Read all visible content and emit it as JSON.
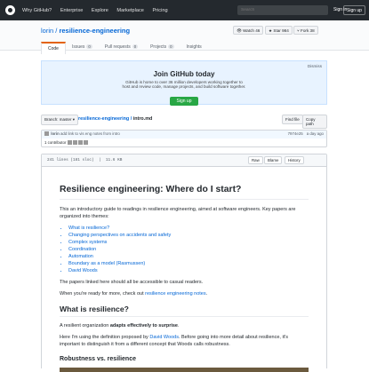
{
  "header": {
    "nav": [
      "Why GitHub?",
      "Enterprise",
      "Explore",
      "Marketplace",
      "Pricing"
    ],
    "search_placeholder": "Search",
    "signin": "Sign in",
    "signup": "Sign up"
  },
  "repo": {
    "owner": "lorin",
    "name": "resilience-engineering",
    "watch": "Watch",
    "watch_count": "46",
    "star": "Star",
    "star_count": "984",
    "fork": "Fork",
    "fork_count": "38"
  },
  "tabs": [
    {
      "label": "Code"
    },
    {
      "label": "Issues",
      "count": "0"
    },
    {
      "label": "Pull requests",
      "count": "0"
    },
    {
      "label": "Projects",
      "count": "0"
    },
    {
      "label": "Insights"
    }
  ],
  "join": {
    "title": "Join GitHub today",
    "text": "GitHub is home to over 36 million developers working together to host and review code, manage projects, and build software together.",
    "button": "Sign up",
    "dismiss": "Dismiss"
  },
  "file": {
    "branch": "Branch: master",
    "repo_link": "resilience-engineering",
    "sep": "/",
    "file": "intro.md",
    "find": "Find file",
    "copy": "Copy path"
  },
  "commit": {
    "author": "lorin",
    "message": "add link to vis eng notes from intro",
    "sha": "7974e25",
    "time": "a day ago",
    "contributors": "1 contributor"
  },
  "fileheader": {
    "lines": "241 lines (181 sloc)",
    "size": "11.6 KB",
    "raw": "Raw",
    "blame": "Blame",
    "history": "History"
  },
  "doc": {
    "h1": "Resilience engineering: Where do I start?",
    "intro": "This an introductory guide to readings in resilience engineering, aimed at software engineers. Key papers are organized into themes:",
    "themes": [
      "What is resilience?",
      "Changing perspectives on accidents and safety",
      "Complex systems",
      "Coordination",
      "Automation",
      "Boundary as a model (Rasmussen)",
      "David Woods"
    ],
    "p2": "The papers linked here should all be accessible to casual readers.",
    "p3_pre": "When you're ready for more, check out ",
    "p3_link": "resilience engineering notes",
    "h2": "What is resilience?",
    "p4_pre": "A resilient organization ",
    "p4_bold": "adapts effectively to surprise",
    "p5_pre": "Here I'm using the definition proposed by ",
    "p5_link": "David Woods",
    "p5_post": ". Before going into more detail about resilience, it's important to distinguish it from a different concept that Woods calls robustness.",
    "h3": "Robustness vs. resilience"
  }
}
